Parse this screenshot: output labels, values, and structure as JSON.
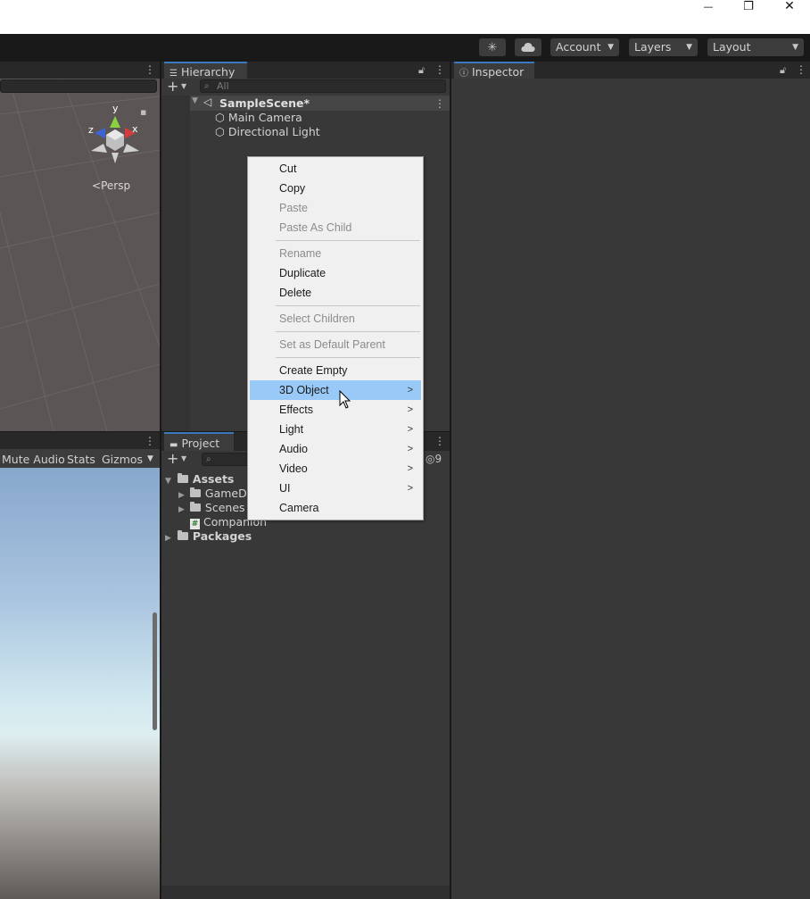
{
  "window": {
    "minimize": "—",
    "restore": "❐",
    "close": "✕"
  },
  "toolbar": {
    "account": "Account",
    "layers": "Layers",
    "layout": "Layout",
    "collab_icon": "cloud-icon",
    "services_icon": "services-icon"
  },
  "scene": {
    "gizmo": {
      "y": "y",
      "x": "x",
      "z": "z"
    },
    "persp": "Persp"
  },
  "game": {
    "mute_audio": "Mute Audio",
    "stats": "Stats",
    "gizmos": "Gizmos"
  },
  "hierarchy": {
    "tab": "Hierarchy",
    "search_placeholder": "All",
    "scene_name": "SampleScene*",
    "objects": [
      "Main Camera",
      "Directional Light"
    ]
  },
  "project": {
    "tab": "Project",
    "hidden_count": "9",
    "assets": "Assets",
    "children": [
      "GameDe",
      "Scenes",
      "Companion"
    ],
    "packages": "Packages"
  },
  "inspector": {
    "tab": "Inspector"
  },
  "menu": {
    "items": [
      {
        "label": "Cut",
        "enabled": true
      },
      {
        "label": "Copy",
        "enabled": true
      },
      {
        "label": "Paste",
        "enabled": false
      },
      {
        "label": "Paste As Child",
        "enabled": false
      },
      {
        "label": "Rename",
        "enabled": false
      },
      {
        "label": "Duplicate",
        "enabled": true
      },
      {
        "label": "Delete",
        "enabled": true
      },
      {
        "label": "Select Children",
        "enabled": false
      },
      {
        "label": "Set as Default Parent",
        "enabled": false
      },
      {
        "label": "Create Empty",
        "enabled": true
      },
      {
        "label": "3D Object",
        "enabled": true,
        "submenu": true,
        "highlighted": true
      },
      {
        "label": "Effects",
        "enabled": true,
        "submenu": true
      },
      {
        "label": "Light",
        "enabled": true,
        "submenu": true
      },
      {
        "label": "Audio",
        "enabled": true,
        "submenu": true
      },
      {
        "label": "Video",
        "enabled": true,
        "submenu": true
      },
      {
        "label": "UI",
        "enabled": true,
        "submenu": true
      },
      {
        "label": "Camera",
        "enabled": true
      }
    ]
  },
  "colors": {
    "highlight": "#99c9f7",
    "panel": "#383838",
    "tab_accent": "#3a79bb"
  }
}
